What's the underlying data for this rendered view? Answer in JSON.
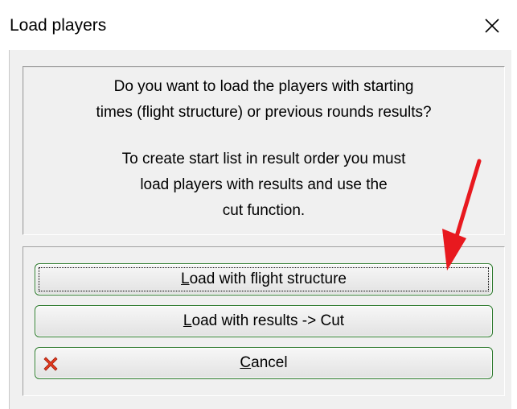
{
  "window": {
    "title": "Load players",
    "close_glyph": "✕"
  },
  "message": {
    "line1": "Do you want to load the players with starting",
    "line2": "times (flight structure) or previous rounds results?",
    "line3": "To create start list in result order you must",
    "line4": "load players with results and use the",
    "line5": "cut function."
  },
  "buttons": {
    "flight": {
      "mnemonic": "L",
      "rest": "oad with flight structure"
    },
    "results": {
      "mnemonic": "L",
      "rest": "oad with results -> Cut"
    },
    "cancel": {
      "mnemonic": "C",
      "rest": "ancel",
      "icon": "red-x-icon"
    }
  },
  "colors": {
    "button_border": "#2d7a2d",
    "cancel_icon": "#e53a1e",
    "annotation_arrow": "#e8191f"
  }
}
